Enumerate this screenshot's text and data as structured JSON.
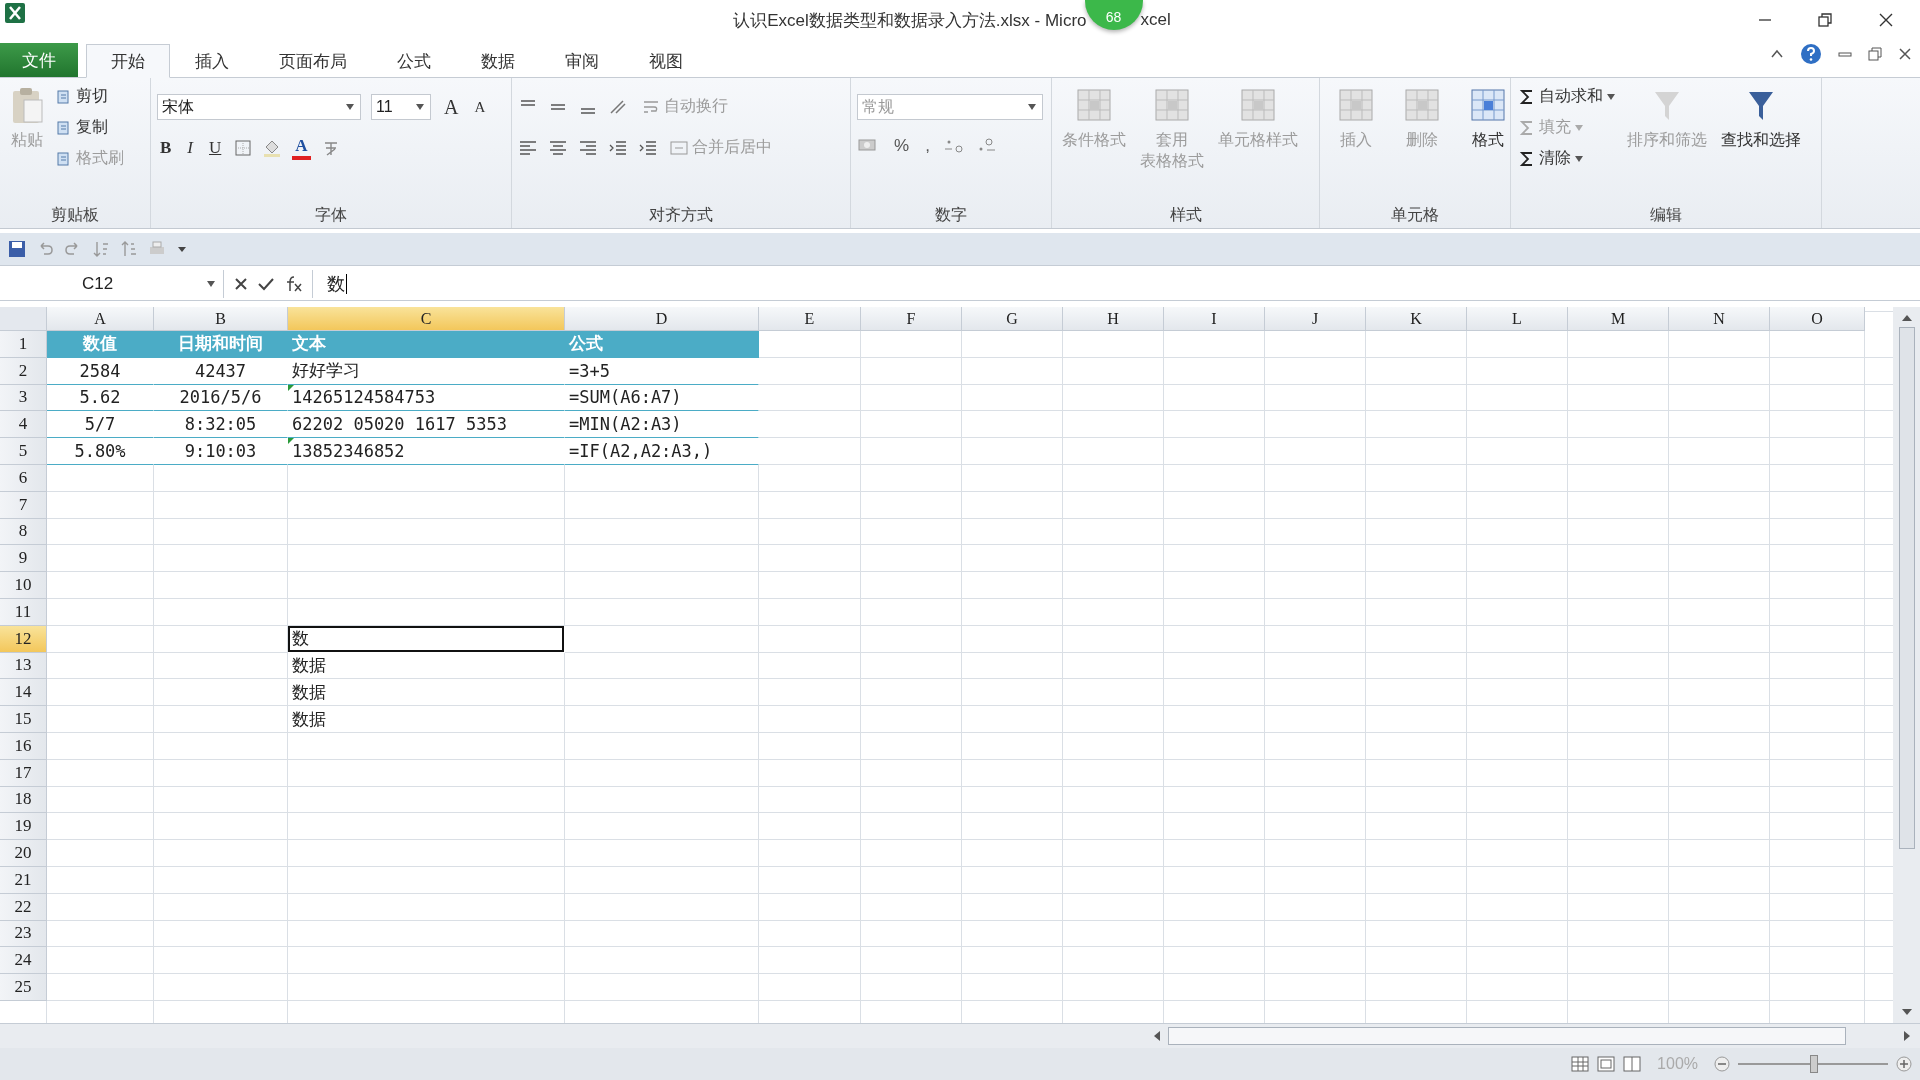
{
  "title_bar": {
    "title": "认识Excel数据类型和数据录入方法.xlsx - Micro",
    "title_tail": "xcel",
    "badge": "68"
  },
  "menu_tabs": [
    {
      "label": "文件",
      "kind": "file",
      "selected": false
    },
    {
      "label": "开始",
      "kind": "tab",
      "selected": true
    },
    {
      "label": "插入",
      "kind": "tab",
      "selected": false
    },
    {
      "label": "页面布局",
      "kind": "tab",
      "selected": false
    },
    {
      "label": "公式",
      "kind": "tab",
      "selected": false
    },
    {
      "label": "数据",
      "kind": "tab",
      "selected": false
    },
    {
      "label": "审阅",
      "kind": "tab",
      "selected": false
    },
    {
      "label": "视图",
      "kind": "tab",
      "selected": false
    }
  ],
  "ribbon": {
    "groups": [
      {
        "kind": "clipboard",
        "label": "剪贴板",
        "items": [
          {
            "label": "粘贴",
            "disabled": true
          },
          {
            "label": "剪切",
            "disabled": false
          },
          {
            "label": "复制",
            "disabled": false
          },
          {
            "label": "格式刷",
            "disabled": true
          }
        ]
      },
      {
        "kind": "font",
        "label": "字体",
        "font": "宋体",
        "size": "11",
        "grow": "A",
        "shrink": "A",
        "buttons": [
          "B",
          "I",
          "U"
        ],
        "font_color": "A"
      },
      {
        "kind": "align",
        "label": "对齐方式",
        "items": [
          {
            "label": "自动换行",
            "disabled": true
          },
          {
            "label": "合并后居中",
            "disabled": true
          }
        ]
      },
      {
        "kind": "number",
        "label": "数字",
        "format": "常规",
        "symbols": [
          "%",
          ","
        ]
      },
      {
        "kind": "large",
        "label": "样式",
        "items": [
          {
            "label": "条件格式",
            "disabled": true
          },
          {
            "lines": [
              "套用",
              "表格格式"
            ],
            "disabled": true
          },
          {
            "label": "单元格样式",
            "disabled": true
          }
        ]
      },
      {
        "kind": "large",
        "label": "单元格",
        "items": [
          {
            "label": "插入",
            "disabled": true
          },
          {
            "label": "删除",
            "disabled": true
          },
          {
            "label": "格式",
            "disabled": false
          }
        ]
      },
      {
        "kind": "edit",
        "label": "编辑",
        "items": [
          {
            "label": "自动求和",
            "kind": "small",
            "disabled": false
          },
          {
            "label": "填充",
            "kind": "small",
            "disabled": true
          },
          {
            "label": "清除",
            "kind": "small",
            "disabled": false
          },
          {
            "label": "排序和筛选",
            "kind": "large",
            "disabled": true
          },
          {
            "label": "查找和选择",
            "kind": "large",
            "disabled": false
          }
        ]
      }
    ]
  },
  "formula_bar": {
    "name_box": "C12",
    "formula": "数"
  },
  "sheet": {
    "columns": [
      {
        "label": "A",
        "selected": false
      },
      {
        "label": "B",
        "selected": false
      },
      {
        "label": "C",
        "selected": true
      },
      {
        "label": "D",
        "selected": false
      },
      {
        "label": "E",
        "selected": false
      },
      {
        "label": "F",
        "selected": false
      },
      {
        "label": "G",
        "selected": false
      },
      {
        "label": "H",
        "selected": false
      },
      {
        "label": "I",
        "selected": false
      },
      {
        "label": "J",
        "selected": false
      },
      {
        "label": "K",
        "selected": false
      },
      {
        "label": "L",
        "selected": false
      },
      {
        "label": "M",
        "selected": false
      },
      {
        "label": "N",
        "selected": false
      },
      {
        "label": "O",
        "selected": false
      }
    ],
    "rows": [
      {
        "number": "1",
        "kind": "table_header",
        "selected": false,
        "cells": [
          {
            "text": "数值"
          },
          {
            "text": "日期和时间"
          },
          {
            "text": "文本"
          },
          {
            "text": "公式"
          }
        ]
      },
      {
        "number": "2",
        "kind": "table_row",
        "selected": false,
        "cells": [
          {
            "text": "2584"
          },
          {
            "text": "42437"
          },
          {
            "text": "好好学习"
          },
          {
            "text": "=3+5"
          }
        ]
      },
      {
        "number": "3",
        "kind": "table_row",
        "selected": false,
        "cells": [
          {
            "text": "5.62"
          },
          {
            "text": "2016/5/6"
          },
          {
            "text": "14265124584753",
            "flag": true
          },
          {
            "text": "=SUM(A6:A7)"
          }
        ]
      },
      {
        "number": "4",
        "kind": "table_row",
        "selected": false,
        "cells": [
          {
            "text": "5/7"
          },
          {
            "text": "8:32:05"
          },
          {
            "text": "62202 05020 1617 5353"
          },
          {
            "text": "=MIN(A2:A3)"
          }
        ]
      },
      {
        "number": "5",
        "kind": "table_row",
        "selected": false,
        "cells": [
          {
            "text": "5.80%"
          },
          {
            "text": "9:10:03"
          },
          {
            "text": "13852346852",
            "flag": true
          },
          {
            "text": "=IF(A2,A2:A3,)"
          }
        ]
      },
      {
        "number": "6",
        "selected": false
      },
      {
        "number": "7",
        "selected": false
      },
      {
        "number": "8",
        "selected": false
      },
      {
        "number": "9",
        "selected": false
      },
      {
        "number": "10",
        "selected": false
      },
      {
        "number": "11",
        "selected": false
      },
      {
        "number": "12",
        "selected": true,
        "cells": [
          null,
          null,
          {
            "text": "数",
            "selected": true
          }
        ]
      },
      {
        "number": "13",
        "selected": false,
        "cells": [
          null,
          null,
          {
            "text": "数据"
          }
        ]
      },
      {
        "number": "14",
        "selected": false,
        "cells": [
          null,
          null,
          {
            "text": "数据"
          }
        ]
      },
      {
        "number": "15",
        "selected": false,
        "cells": [
          null,
          null,
          {
            "text": "数据"
          }
        ]
      },
      {
        "number": "16",
        "selected": false
      },
      {
        "number": "17",
        "selected": false
      },
      {
        "number": "18",
        "selected": false
      },
      {
        "number": "19",
        "selected": false
      },
      {
        "number": "20",
        "selected": false
      },
      {
        "number": "21",
        "selected": false
      },
      {
        "number": "22",
        "selected": false
      },
      {
        "number": "23",
        "selected": false
      },
      {
        "number": "24",
        "selected": false
      },
      {
        "number": "25",
        "selected": false
      }
    ]
  },
  "status_bar": {
    "zoom": "100%",
    "zoom_slider": {
      "level": 0.5
    }
  }
}
